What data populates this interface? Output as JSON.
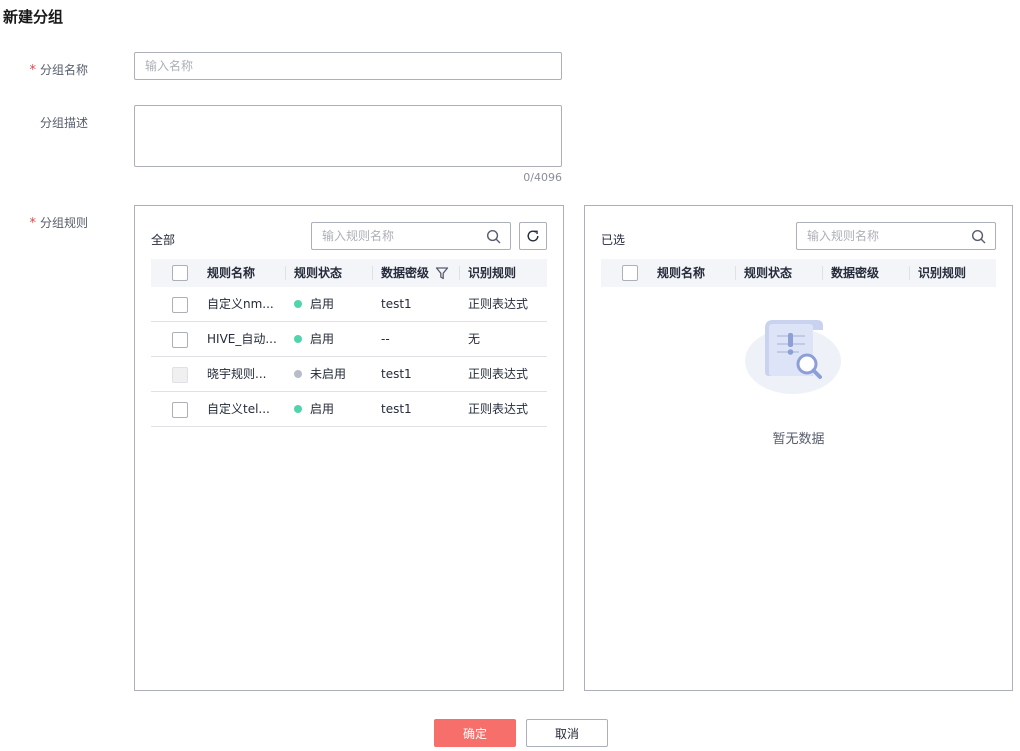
{
  "page": {
    "title": "新建分组"
  },
  "form": {
    "name_label": "分组名称",
    "name_placeholder": "输入名称",
    "desc_label": "分组描述",
    "desc_counter": "0/4096",
    "rules_label": "分组规则",
    "required_mark": "*"
  },
  "left_panel": {
    "title": "全部",
    "search_placeholder": "输入规则名称",
    "columns": [
      "规则名称",
      "规则状态",
      "数据密级",
      "识别规则"
    ],
    "rows": [
      {
        "name": "自定义nm...",
        "status": "启用",
        "status_key": "enabled",
        "level": "test1",
        "rule": "正则表达式",
        "disabled": false
      },
      {
        "name": "HIVE_自动...",
        "status": "启用",
        "status_key": "enabled",
        "level": "--",
        "rule": "无",
        "disabled": false
      },
      {
        "name": "晓宇规则...",
        "status": "未启用",
        "status_key": "disabled",
        "level": "test1",
        "rule": "正则表达式",
        "disabled": true
      },
      {
        "name": "自定义tel...",
        "status": "启用",
        "status_key": "enabled",
        "level": "test1",
        "rule": "正则表达式",
        "disabled": false
      }
    ]
  },
  "right_panel": {
    "title": "已选",
    "search_placeholder": "输入规则名称",
    "columns": [
      "规则名称",
      "规则状态",
      "数据密级",
      "识别规则"
    ],
    "empty_text": "暂无数据"
  },
  "buttons": {
    "confirm": "确定",
    "cancel": "取消"
  },
  "colors": {
    "enabled": "#50d4ab",
    "disabled": "#b8bcc9",
    "primary": "#f66f6a",
    "required": "#e54545"
  },
  "icons": [
    "search-icon",
    "refresh-icon",
    "filter-icon",
    "empty-data-icon"
  ]
}
